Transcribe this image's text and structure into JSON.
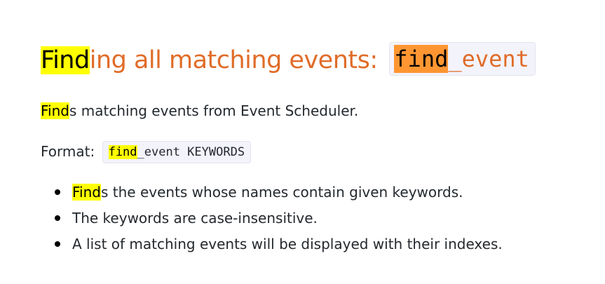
{
  "heading": {
    "highlight": "Find",
    "rest": "ing all matching events: ",
    "code_highlight": "find",
    "code_rest": "_event"
  },
  "paragraph1": {
    "highlight": "Find",
    "rest": "s matching events from Event Scheduler."
  },
  "format": {
    "label": "Format: ",
    "code_highlight": "find",
    "code_rest": "_event KEYWORDS"
  },
  "bullets": [
    {
      "highlight": "Find",
      "rest": "s the events whose names contain given keywords."
    },
    {
      "highlight": "",
      "rest": "The keywords are case-insensitive."
    },
    {
      "highlight": "",
      "rest": "A list of matching events will be displayed with their indexes."
    }
  ],
  "colors": {
    "heading": "#e06c28",
    "search_highlight": "#ffff00",
    "active_highlight": "#ff9632",
    "code_background": "#f3f3fc",
    "text": "#24292e"
  }
}
